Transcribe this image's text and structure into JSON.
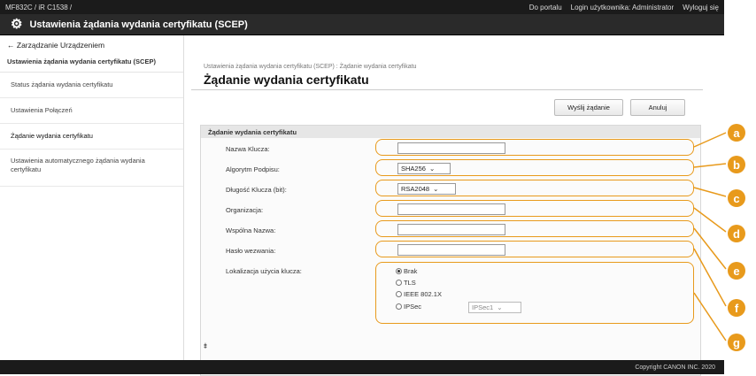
{
  "topbar": {
    "model": "MF832C / iR C1538 /",
    "portal": "Do portalu",
    "login": "Login użytkownika: Administrator",
    "logout": "Wyloguj się"
  },
  "title": "Ustawienia żądania wydania certyfikatu (SCEP)",
  "sidebar": {
    "back": "Zarządzanie Urządzeniem",
    "section": "Ustawienia żądania wydania certyfikatu (SCEP)",
    "items": [
      {
        "label": "Status żądania wydania certyfikatu"
      },
      {
        "label": "Ustawienia Połączeń"
      },
      {
        "label": "Żądanie wydania certyfikatu"
      },
      {
        "label": "Ustawienia automatycznego żądania wydania certyfikatu"
      }
    ]
  },
  "breadcrumb": "Ustawienia żądania wydania certyfikatu (SCEP) : Żądanie wydania certyfikatu",
  "page_title": "Żądanie wydania certyfikatu",
  "buttons": {
    "send": "Wyślij żądanie",
    "cancel": "Anuluj"
  },
  "panel": {
    "heading": "Żądanie wydania certyfikatu",
    "fields": {
      "key_name": {
        "label": "Nazwa Klucza:",
        "value": ""
      },
      "signature_algorithm": {
        "label": "Algorytm Podpisu:",
        "value": "SHA256"
      },
      "key_length": {
        "label": "Długość Klucza (bit):",
        "value": "RSA2048"
      },
      "organization": {
        "label": "Organizacja:",
        "value": ""
      },
      "common_name": {
        "label": "Wspólna Nazwa:",
        "value": ""
      },
      "challenge_password": {
        "label": "Hasło wezwania:",
        "value": ""
      },
      "key_usage": {
        "label": "Lokalizacja użycia klucza:",
        "options": [
          "Brak",
          "TLS",
          "IEEE 802.1X",
          "IPSec"
        ],
        "selected": "Brak",
        "ipsec_select": "IPSec1"
      }
    }
  },
  "callouts": [
    "a",
    "b",
    "c",
    "d",
    "e",
    "f",
    "g"
  ],
  "footer": "Copyright CANON INC. 2020",
  "colors": {
    "callout": "#e89a1c",
    "topbar": "#1b1b1b",
    "titlebar": "#2a2a2a"
  }
}
